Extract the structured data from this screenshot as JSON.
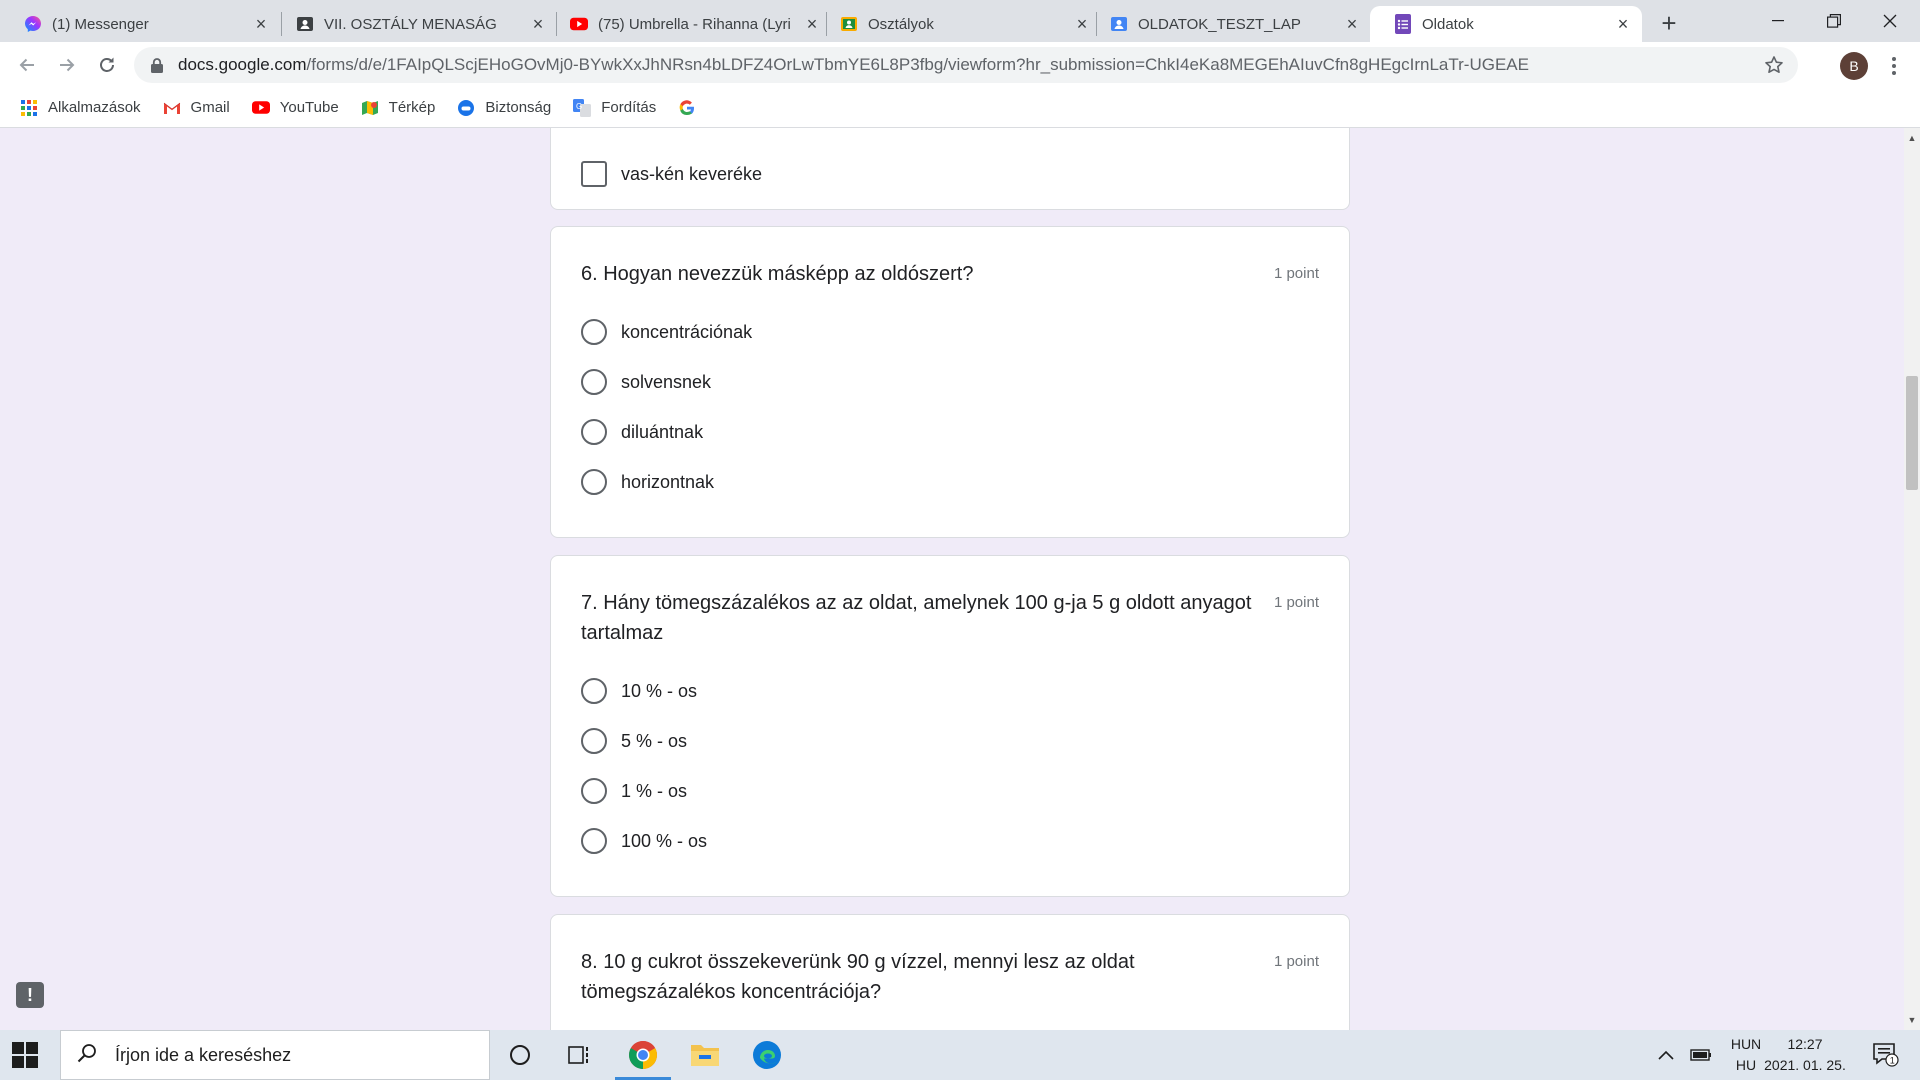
{
  "browser": {
    "tabs": [
      {
        "title": "(1) Messenger",
        "icon": "messenger-icon"
      },
      {
        "title": "VII. OSZTÁLY MENASÁG",
        "icon": "classroom-icon"
      },
      {
        "title": "(75) Umbrella - Rihanna (Lyri",
        "icon": "youtube-icon"
      },
      {
        "title": "Osztályok",
        "icon": "classroom-icon"
      },
      {
        "title": "OLDATOK_TESZT_LAP",
        "icon": "forms-person-icon"
      },
      {
        "title": "Oldatok",
        "icon": "forms-icon",
        "active": true
      }
    ],
    "url_host": "docs.google.com",
    "url_path": "/forms/d/e/1FAIpQLScjEHoGOvMj0-BYwkXxJhNRsn4bLDFZ4OrLwTbmYE6L8P3fbg/viewform?hr_submission=ChkI4eKa8MEGEhAIuvCfn8gHEgcIrnLaTr-UGEAE",
    "profile_initial": "B",
    "bookmarks": [
      {
        "label": "Alkalmazások",
        "icon": "apps-grid-icon"
      },
      {
        "label": "Gmail",
        "icon": "gmail-icon"
      },
      {
        "label": "YouTube",
        "icon": "youtube-icon"
      },
      {
        "label": "Térkép",
        "icon": "maps-icon"
      },
      {
        "label": "Biztonság",
        "icon": "security-icon"
      },
      {
        "label": "Fordítás",
        "icon": "translate-icon"
      },
      {
        "label": "",
        "icon": "google-icon"
      }
    ]
  },
  "form": {
    "prev_option": "vas-kén keveréke",
    "questions": [
      {
        "title": "6. Hogyan nevezzük másképp az oldószert?",
        "points": "1 point",
        "options": [
          "koncentrációnak",
          "solvensnek",
          "diluántnak",
          "horizontnak"
        ]
      },
      {
        "title": "7. Hány tömegszázalékos az az oldat, amelynek 100 g-ja 5 g oldott anyagot tartalmaz",
        "points": "1 point",
        "options": [
          "10 % - os",
          "5 % - os",
          "1 % - os",
          "100 % - os"
        ]
      },
      {
        "title": "8. 10 g cukrot összekeverünk 90 g vízzel, mennyi lesz az oldat tömegszázalékos koncentrációja?",
        "points": "1 point",
        "options": []
      }
    ]
  },
  "taskbar": {
    "search_placeholder": "Írjon ide a kereséshez",
    "lang_top": "HUN",
    "lang_bottom": "HU",
    "time": "12:27",
    "date": "2021. 01. 25.",
    "notification_count": "1"
  },
  "colors": {
    "form_bg": "#f0ebf8",
    "tabstrip_bg": "#dee1e6",
    "taskbar_bg": "#dfe6ee"
  }
}
